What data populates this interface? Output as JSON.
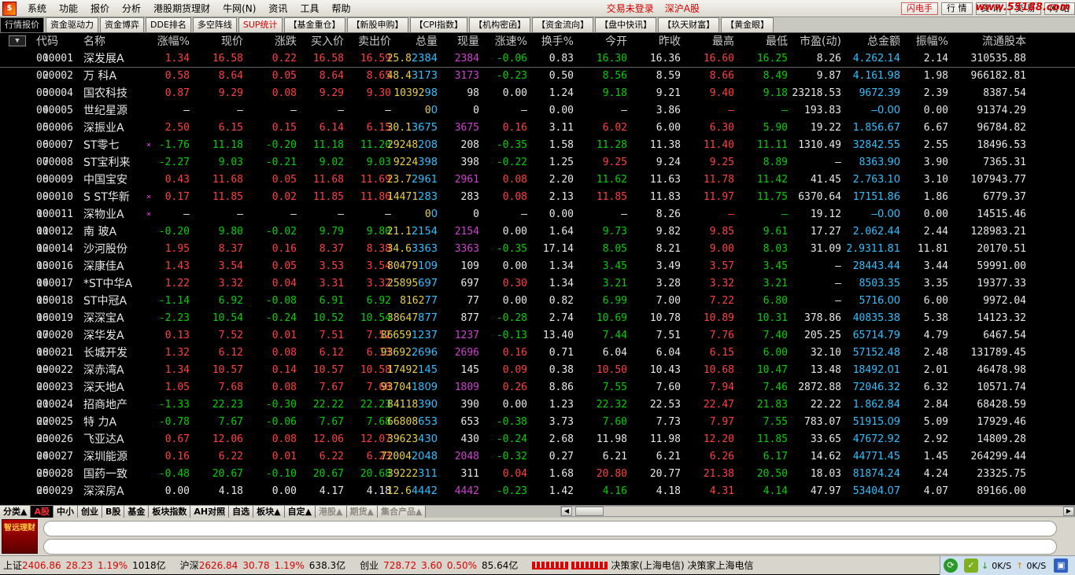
{
  "menubar": {
    "items": [
      "系统",
      "功能",
      "报价",
      "分析",
      "港股期货理财",
      "牛网(N)",
      "资讯",
      "工具",
      "帮助"
    ],
    "status1": "交易未登录",
    "status2": "深沪A股",
    "right_buttons": [
      "闪电手",
      "行 情",
      "资 讯",
      "交 易",
      "网 站"
    ],
    "site": "www.55188.com"
  },
  "tabs": [
    "行情报价",
    "资金驱动力",
    "资金博弈",
    "DDE排名",
    "多空阵线",
    "SUP统计",
    "【基金重仓】",
    "【新股申购】",
    "【CPI指数】",
    "【机构密函】",
    "【资金流向】",
    "【盘中快讯】",
    "【玖天财富】",
    "【黄金眼】"
  ],
  "table": {
    "sort_button": "▼",
    "headers": [
      "代码",
      "名称",
      "涨幅%",
      "现价",
      "涨跌",
      "买入价",
      "卖出价",
      "总量",
      "现量",
      "涨速%",
      "换手%",
      "今开",
      "昨收",
      "最高",
      "最低",
      "市盈(动)",
      "总金额",
      "振幅%",
      "流通股本"
    ],
    "rows": [
      [
        "1",
        "000001",
        "深发展A",
        "",
        "1.34",
        "16.58",
        "0.22",
        "16.58",
        "16.59",
        "25.8",
        "万",
        "2384",
        "-0.06",
        "0.83",
        "16.30",
        "16.36",
        "16.60",
        "16.25",
        "8.26",
        "4.26",
        "亿",
        "2.14",
        "310535.88"
      ],
      [
        "2",
        "000002",
        "万  科A",
        "",
        "0.58",
        "8.64",
        "0.05",
        "8.64",
        "8.65",
        "48.4",
        "万",
        "3173",
        "-0.23",
        "0.50",
        "8.56",
        "8.59",
        "8.66",
        "8.49",
        "9.87",
        "4.16",
        "亿",
        "1.98",
        "966182.81"
      ],
      [
        "3",
        "000004",
        "国农科技",
        "",
        "0.87",
        "9.29",
        "0.08",
        "9.29",
        "9.30",
        "10392",
        "",
        "98",
        "0.00",
        "1.24",
        "9.18",
        "9.21",
        "9.40",
        "9.18",
        "23218.53",
        "967",
        "万",
        "2.39",
        "8387.54"
      ],
      [
        "4",
        "000005",
        "世纪星源",
        "",
        "—",
        "—",
        "—",
        "—",
        "—",
        "0",
        "",
        "0",
        "—",
        "0.00",
        "—",
        "3.86",
        "—",
        "—",
        "193.83",
        "—",
        "",
        "0.00",
        "91374.29"
      ],
      [
        "5",
        "000006",
        "深振业A",
        "",
        "2.50",
        "6.15",
        "0.15",
        "6.14",
        "6.15",
        "30.1",
        "万",
        "3675",
        "0.16",
        "3.11",
        "6.02",
        "6.00",
        "6.30",
        "5.90",
        "19.22",
        "1.85",
        "亿",
        "6.67",
        "96784.82"
      ],
      [
        "6",
        "000007",
        "ST零七",
        "×",
        "-1.76",
        "11.18",
        "-0.20",
        "11.18",
        "11.20",
        "29248",
        "",
        "208",
        "-0.35",
        "1.58",
        "11.28",
        "11.38",
        "11.40",
        "11.11",
        "1310.49",
        "3284",
        "万",
        "2.55",
        "18496.53"
      ],
      [
        "7",
        "000008",
        "ST宝利来",
        "",
        "-2.27",
        "9.03",
        "-0.21",
        "9.02",
        "9.03",
        "9224",
        "",
        "398",
        "-0.22",
        "1.25",
        "9.25",
        "9.24",
        "9.25",
        "8.89",
        "—",
        "836",
        "万",
        "3.90",
        "7365.31"
      ],
      [
        "8",
        "000009",
        "中国宝安",
        "",
        "0.43",
        "11.68",
        "0.05",
        "11.68",
        "11.69",
        "23.7",
        "万",
        "2961",
        "0.08",
        "2.20",
        "11.62",
        "11.63",
        "11.78",
        "11.42",
        "41.45",
        "2.76",
        "亿",
        "3.10",
        "107943.77"
      ],
      [
        "9",
        "000010",
        "S ST华新",
        "×",
        "0.17",
        "11.85",
        "0.02",
        "11.85",
        "11.86",
        "14471",
        "",
        "283",
        "0.08",
        "2.13",
        "11.85",
        "11.83",
        "11.97",
        "11.75",
        "6370.64",
        "1715",
        "万",
        "1.86",
        "6779.37"
      ],
      [
        "10",
        "000011",
        "深物业A",
        "×",
        "—",
        "—",
        "—",
        "—",
        "—",
        "0",
        "",
        "0",
        "—",
        "0.00",
        "—",
        "8.26",
        "—",
        "—",
        "19.12",
        "—",
        "",
        "0.00",
        "14515.46"
      ],
      [
        "11",
        "000012",
        "南  玻A",
        "",
        "-0.20",
        "9.80",
        "-0.02",
        "9.79",
        "9.80",
        "21.1",
        "万",
        "2154",
        "0.00",
        "1.64",
        "9.73",
        "9.82",
        "9.85",
        "9.61",
        "17.27",
        "2.06",
        "亿",
        "2.44",
        "128983.21"
      ],
      [
        "12",
        "000014",
        "沙河股份",
        "",
        "1.95",
        "8.37",
        "0.16",
        "8.37",
        "8.38",
        "34.6",
        "万",
        "3363",
        "-0.35",
        "17.14",
        "8.05",
        "8.21",
        "9.00",
        "8.03",
        "31.09",
        "2.93",
        "亿",
        "11.81",
        "20170.51"
      ],
      [
        "13",
        "000016",
        "深康佳A",
        "",
        "1.43",
        "3.54",
        "0.05",
        "3.53",
        "3.54",
        "80479",
        "",
        "109",
        "0.00",
        "1.34",
        "3.45",
        "3.49",
        "3.57",
        "3.45",
        "—",
        "2844",
        "万",
        "3.44",
        "59991.00"
      ],
      [
        "14",
        "000017",
        "*ST中华A",
        "",
        "1.22",
        "3.32",
        "0.04",
        "3.31",
        "3.32",
        "25895",
        "",
        "697",
        "0.30",
        "1.34",
        "3.21",
        "3.28",
        "3.32",
        "3.21",
        "—",
        "850",
        "万",
        "3.35",
        "19377.33"
      ],
      [
        "15",
        "000018",
        "ST中冠A",
        "",
        "-1.14",
        "6.92",
        "-0.08",
        "6.91",
        "6.92",
        "8162",
        "",
        "77",
        "0.00",
        "0.82",
        "6.99",
        "7.00",
        "7.22",
        "6.80",
        "—",
        "571",
        "万",
        "6.00",
        "9972.04"
      ],
      [
        "16",
        "000019",
        "深深宝A",
        "",
        "-2.23",
        "10.54",
        "-0.24",
        "10.52",
        "10.54",
        "38647",
        "",
        "877",
        "-0.28",
        "2.74",
        "10.69",
        "10.78",
        "10.89",
        "10.31",
        "378.86",
        "4083",
        "万",
        "5.38",
        "14123.32"
      ],
      [
        "17",
        "000020",
        "深华发A",
        "",
        "0.13",
        "7.52",
        "0.01",
        "7.51",
        "7.52",
        "86659",
        "",
        "1237",
        "-0.13",
        "13.40",
        "7.44",
        "7.51",
        "7.76",
        "7.40",
        "205.25",
        "6571",
        "万",
        "4.79",
        "6467.54"
      ],
      [
        "18",
        "000021",
        "长城开发",
        "",
        "1.32",
        "6.12",
        "0.08",
        "6.12",
        "6.13",
        "93692",
        "",
        "2696",
        "0.16",
        "0.71",
        "6.04",
        "6.04",
        "6.15",
        "6.00",
        "32.10",
        "5715",
        "万",
        "2.48",
        "131789.45"
      ],
      [
        "19",
        "000022",
        "深赤湾A",
        "",
        "1.34",
        "10.57",
        "0.14",
        "10.57",
        "10.58",
        "17492",
        "",
        "145",
        "0.09",
        "0.38",
        "10.50",
        "10.43",
        "10.68",
        "10.47",
        "13.48",
        "1849",
        "万",
        "2.01",
        "46478.98"
      ],
      [
        "20",
        "000023",
        "深天地A",
        "",
        "1.05",
        "7.68",
        "0.08",
        "7.67",
        "7.68",
        "93704",
        "",
        "1809",
        "0.26",
        "8.86",
        "7.55",
        "7.60",
        "7.94",
        "7.46",
        "2872.88",
        "7204",
        "万",
        "6.32",
        "10571.74"
      ],
      [
        "21",
        "000024",
        "招商地产",
        "",
        "-1.33",
        "22.23",
        "-0.30",
        "22.22",
        "22.23",
        "84118",
        "",
        "390",
        "0.00",
        "1.23",
        "22.32",
        "22.53",
        "22.47",
        "21.83",
        "22.22",
        "1.86",
        "亿",
        "2.84",
        "68428.59"
      ],
      [
        "22",
        "000025",
        "特  力A",
        "",
        "-0.78",
        "7.67",
        "-0.06",
        "7.67",
        "7.68",
        "66808",
        "",
        "653",
        "-0.38",
        "3.73",
        "7.60",
        "7.73",
        "7.97",
        "7.55",
        "783.07",
        "5191",
        "万",
        "5.09",
        "17929.46"
      ],
      [
        "23",
        "000026",
        "飞亚达A",
        "",
        "0.67",
        "12.06",
        "0.08",
        "12.06",
        "12.07",
        "39623",
        "",
        "430",
        "-0.24",
        "2.68",
        "11.98",
        "11.98",
        "12.20",
        "11.85",
        "33.65",
        "4767",
        "万",
        "2.92",
        "14809.28"
      ],
      [
        "24",
        "000027",
        "深圳能源",
        "",
        "0.16",
        "6.22",
        "0.01",
        "6.22",
        "6.23",
        "72004",
        "",
        "2048",
        "-0.32",
        "0.27",
        "6.21",
        "6.21",
        "6.26",
        "6.17",
        "14.62",
        "4477",
        "万",
        "1.45",
        "264299.44"
      ],
      [
        "25",
        "000028",
        "国药一致",
        "",
        "-0.48",
        "20.67",
        "-0.10",
        "20.67",
        "20.68",
        "39222",
        "",
        "311",
        "0.04",
        "1.68",
        "20.80",
        "20.77",
        "21.38",
        "20.50",
        "18.03",
        "8187",
        "万",
        "4.24",
        "23325.75"
      ],
      [
        "26",
        "000029",
        "深深房A",
        "",
        "0.00",
        "4.18",
        "0.00",
        "4.17",
        "4.18",
        "12.6",
        "万",
        "4442",
        "-0.23",
        "1.42",
        "4.16",
        "4.18",
        "4.31",
        "4.14",
        "47.97",
        "5340",
        "万",
        "4.07",
        "89166.00"
      ]
    ]
  },
  "bottom_tabs": [
    "分类▲",
    "A股",
    "中小",
    "创业",
    "B股",
    "基金",
    "板块指数",
    "AH对照",
    "自选",
    "板块▲",
    "自定▲",
    "港股▲",
    "期货▲",
    "集合产品▲"
  ],
  "ad_text": "智远理财",
  "statusbar": {
    "sh_label": "上证",
    "sh_val": "2406.86",
    "sh_chg": "28.23",
    "sh_pct": "1.19%",
    "sh_amt": "1018亿",
    "sz_label": "沪深",
    "sz_val": "2626.84",
    "sz_chg": "30.78",
    "sz_pct": "1.19%",
    "sz_amt": "638.3亿",
    "cy_label": "创业",
    "cy_val": "728.72",
    "cy_chg": "3.60",
    "cy_pct": "0.50%",
    "cy_amt": "85.64亿",
    "server": "决策家(上海电信) 决策家上海电信",
    "down": "0K/S",
    "up": "0K/S"
  },
  "colors": {
    "up": "#ff4040",
    "down": "#00d000",
    "flat": "#e8e8e8",
    "volume": "#e8d040",
    "amount": "#30c0ff",
    "current_volume": "#d040d0"
  }
}
